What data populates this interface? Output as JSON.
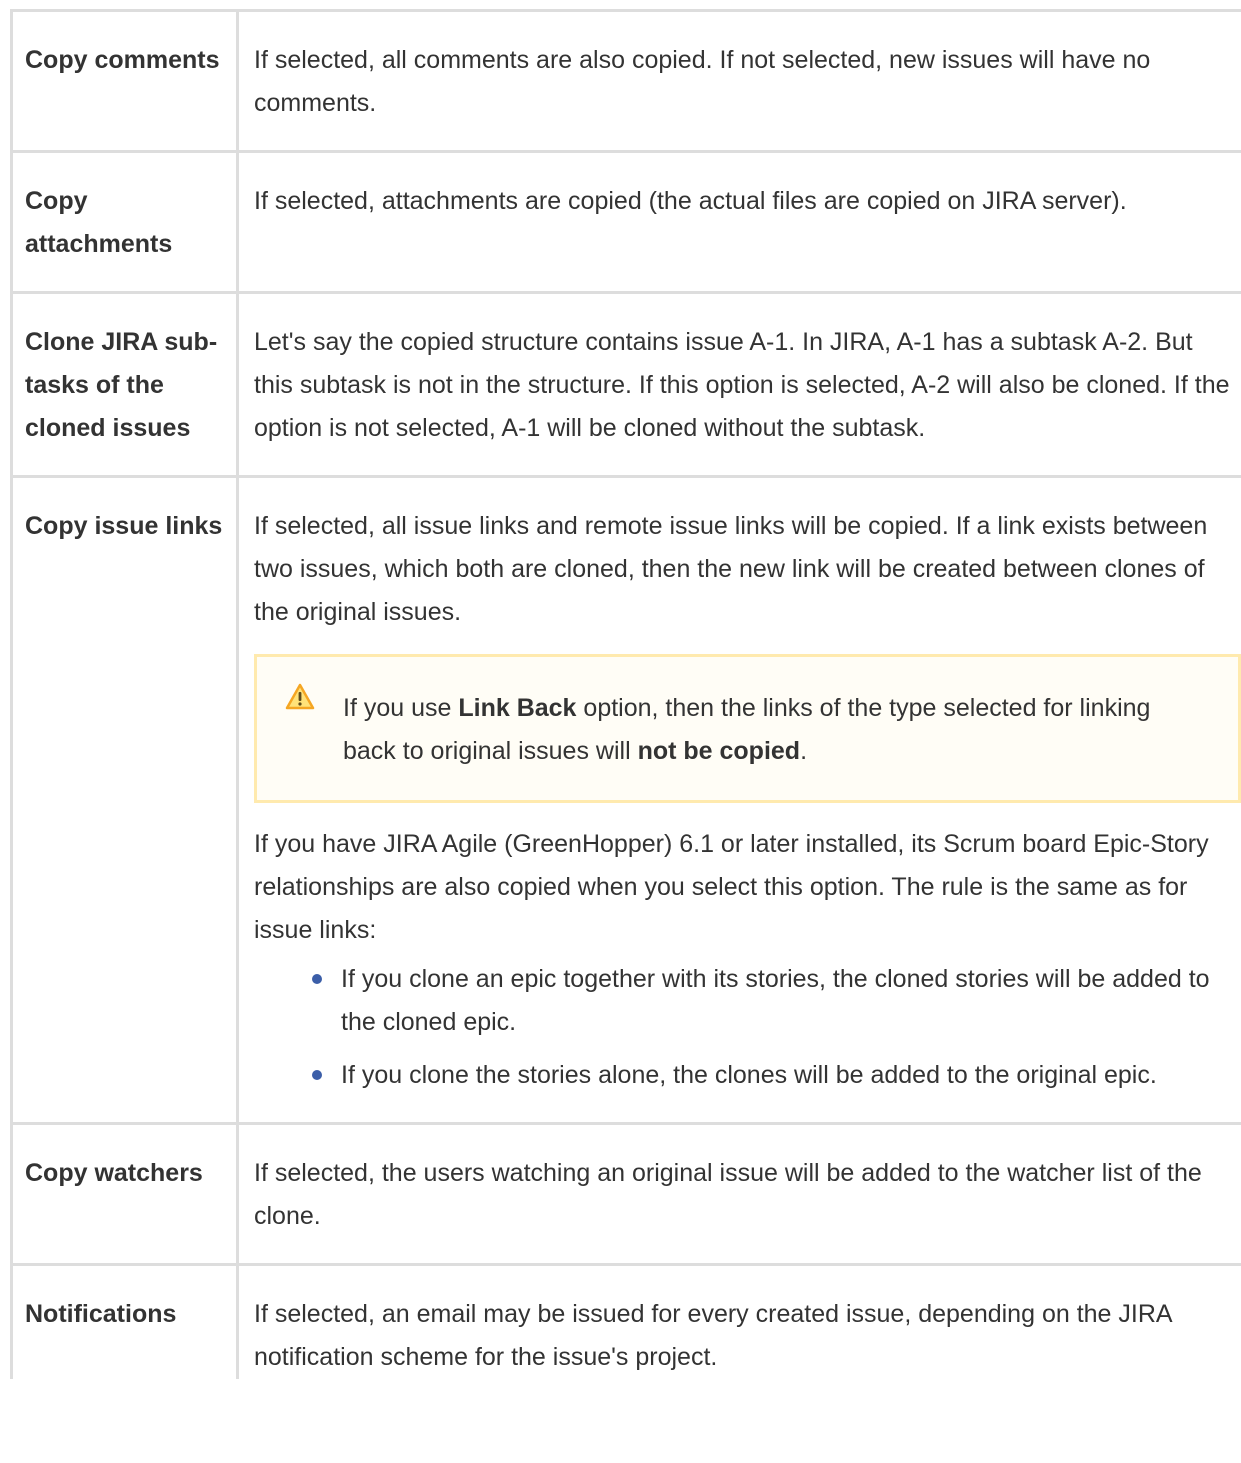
{
  "rows": [
    {
      "label": "Copy comments",
      "description": "If selected, all comments are also copied. If not selected, new issues will have no comments."
    },
    {
      "label": "Copy attachments",
      "description": "If selected, attachments are copied (the actual files are copied on JIRA server)."
    },
    {
      "label": "Clone JIRA sub-tasks of the cloned issues",
      "description": "Let's say the copied structure contains issue A-1. In JIRA, A-1 has a subtask A-2. But this subtask is not in the structure. If this option is selected, A-2 will also be cloned. If the option is not selected, A-1 will be cloned without the subtask."
    },
    {
      "label": "Copy issue links",
      "description": "If selected, all issue links and remote issue links will be copied. If a link exists between two issues, which both are cloned, then the new link will be created between clones of the original issues.",
      "warning": {
        "icon": "warning-icon",
        "text_before": "If you use ",
        "bold_1": "Link Back",
        "text_middle": " option, then the links of the type selected for linking back to original issues will ",
        "bold_2": "not be copied",
        "text_after": "."
      },
      "extra_paragraph": "If you have JIRA Agile (GreenHopper) 6.1 or later installed, its Scrum board Epic-Story relationships are also copied when you select this option. The rule is the same as for issue links:",
      "bullets": [
        "If you clone an epic together with its stories, the cloned stories will be added to the cloned epic.",
        "If you clone the stories alone, the clones will be added to the original epic."
      ]
    },
    {
      "label": "Copy watchers",
      "description": "If selected, the users watching an original issue will be added to the watcher list of the clone."
    },
    {
      "label": "Notifications",
      "description": "If selected, an email may be issued for every created issue, depending on the JIRA notification scheme for the issue's project."
    }
  ],
  "colors": {
    "text": "#333333",
    "border": "#dddddd",
    "warning_border": "#ffeaae",
    "warning_background": "#fffdf6",
    "bullet": "#3b5ea8",
    "warning_icon": "#f5a623"
  }
}
